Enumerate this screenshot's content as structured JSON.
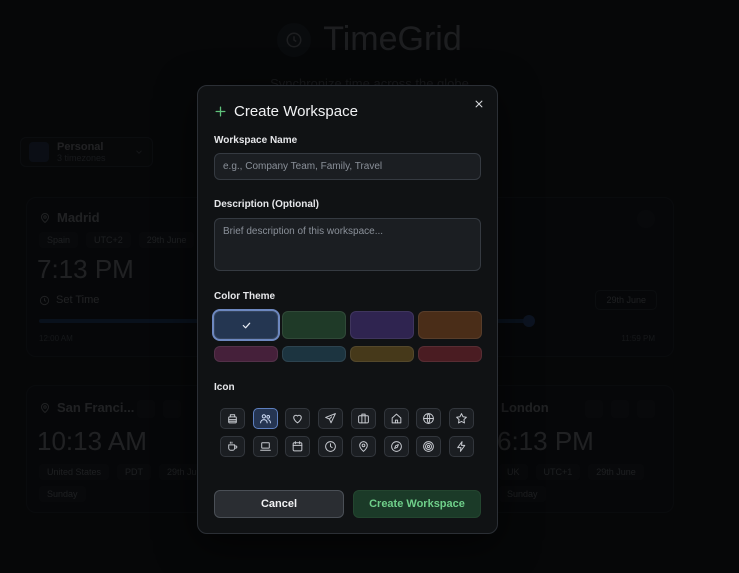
{
  "background": {
    "brand": {
      "title": "TimeGrid",
      "subtitle": "Synchronize time across the globe"
    },
    "workspace_selector": {
      "name": "Personal",
      "count": "3 timezones"
    },
    "cards": {
      "madrid": {
        "city": "Madrid",
        "chips": [
          "Spain",
          "UTC+2",
          "29th June"
        ],
        "time": "7:13 PM",
        "set_time": "Set Time",
        "date_button": "29th June",
        "start_label": "12:00 AM",
        "end_label": "11:59 PM"
      },
      "sf": {
        "city": "San Franci...",
        "time": "10:13 AM",
        "chips": [
          "United States",
          "PDT",
          "29th June"
        ],
        "day": "Sunday"
      },
      "london": {
        "city": "London",
        "time": "6:13 PM",
        "chips": [
          "UK",
          "UTC+1",
          "29th June"
        ],
        "day": "Sunday"
      }
    }
  },
  "modal": {
    "title": "Create Workspace",
    "name_label": "Workspace Name",
    "name_placeholder": "e.g., Company Team, Family, Travel",
    "name_value": "",
    "description_label": "Description (Optional)",
    "description_placeholder": "Brief description of this workspace...",
    "description_value": "",
    "color_label": "Color Theme",
    "colors": [
      "#243651",
      "#1f3a28",
      "#2f2450",
      "#4a2d18",
      "#45203a",
      "#1c3440",
      "#46391a",
      "#4a1c22"
    ],
    "selected_color": 0,
    "icon_label": "Icon",
    "icons": [
      "briefcase-stack-icon",
      "users-icon",
      "heart-icon",
      "plane-icon",
      "suitcase-icon",
      "home-icon",
      "globe-icon",
      "star-icon",
      "coffee-icon",
      "laptop-icon",
      "calendar-icon",
      "clock-icon",
      "map-pin-icon",
      "compass-icon",
      "target-icon",
      "zap-icon"
    ],
    "selected_icon": 1,
    "cancel_label": "Cancel",
    "create_label": "Create Workspace"
  }
}
